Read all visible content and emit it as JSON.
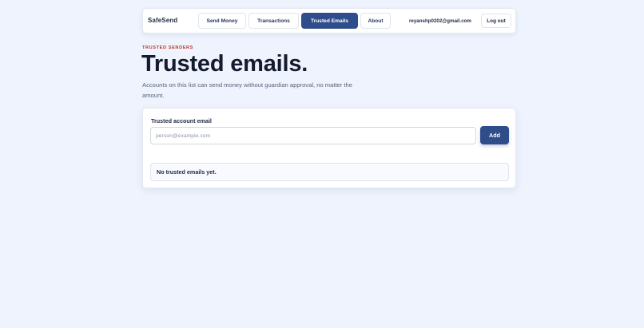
{
  "app": {
    "brand": "SafeSend"
  },
  "nav": {
    "tabs": [
      {
        "label": "Send Money",
        "active": false
      },
      {
        "label": "Transactions",
        "active": false
      },
      {
        "label": "Trusted Emails",
        "active": true
      },
      {
        "label": "About",
        "active": false
      }
    ],
    "user_email": "reyanshp0202@gmail.com",
    "logout_label": "Log out"
  },
  "header": {
    "eyebrow": "TRUSTED SENDERS",
    "title": "Trusted emails.",
    "subtitle": "Accounts on this list can send money without guardian approval, no matter the amount."
  },
  "form": {
    "label": "Trusted account email",
    "input_value": "",
    "input_placeholder": "person@example.com",
    "add_label": "Add"
  },
  "list": {
    "items": [],
    "empty_text": "No trusted emails yet."
  },
  "colors": {
    "background": "#eef3fd",
    "primary": "#2f4d8b",
    "eyebrow": "#c0392b",
    "text": "#151b2e"
  }
}
